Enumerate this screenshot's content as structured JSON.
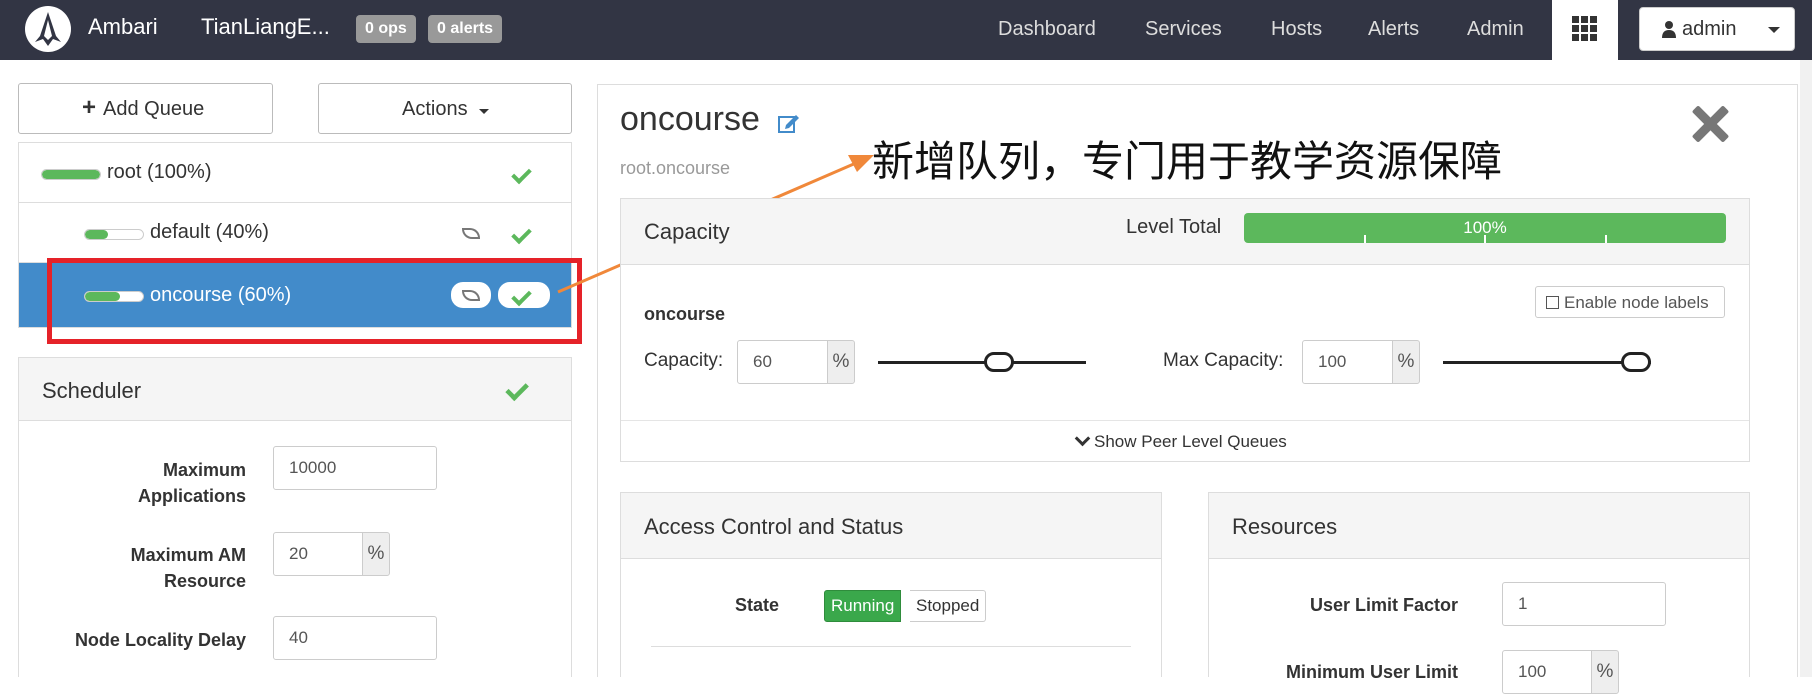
{
  "nav": {
    "brand": "Ambari",
    "cluster": "TianLiangE...",
    "ops_badge": "0 ops",
    "alerts_badge": "0 alerts",
    "links": [
      "Dashboard",
      "Services",
      "Hosts",
      "Alerts",
      "Admin"
    ],
    "user": "admin"
  },
  "toolbar": {
    "add_queue": "Add Queue",
    "actions": "Actions"
  },
  "queues": [
    {
      "label": "root (100%)",
      "fill": 1.0
    },
    {
      "label": "default (40%)",
      "fill": 0.4
    },
    {
      "label": "oncourse (60%)",
      "fill": 0.6
    }
  ],
  "scheduler": {
    "title": "Scheduler",
    "max_apps_label_1": "Maximum",
    "max_apps_label_2": "Applications",
    "max_apps": "10000",
    "max_am_label_1": "Maximum AM",
    "max_am_label_2": "Resource",
    "max_am": "20",
    "percent": "%",
    "locality_label": "Node Locality Delay",
    "locality": "40"
  },
  "detail": {
    "queue_name": "oncourse",
    "queue_path": "root.oncourse",
    "annotation": "新增队列，专门用于教学资源保障",
    "capacity_panel": {
      "title": "Capacity",
      "level_total_label": "Level Total",
      "level_total": "100%",
      "level_total_fraction": 1.0,
      "enable_node_labels": "Enable node labels",
      "queue_heading": "oncourse",
      "capacity_label": "Capacity:",
      "capacity": "60",
      "max_capacity_label": "Max Capacity:",
      "max_capacity": "100",
      "percent": "%",
      "show_peer": "Show Peer Level Queues"
    },
    "access_panel": {
      "title": "Access Control and Status",
      "state_label": "State",
      "state_running": "Running",
      "state_stopped": "Stopped"
    },
    "resources_panel": {
      "title": "Resources",
      "user_limit_factor_label": "User Limit Factor",
      "user_limit_factor": "1",
      "min_user_limit_label": "Minimum User Limit",
      "min_user_limit": "100",
      "percent": "%"
    }
  },
  "colors": {
    "nav_bg": "#323544",
    "selected": "#428bca",
    "ok": "#5cb85c",
    "highlight": "#e52229",
    "arrow": "#f0883a"
  }
}
